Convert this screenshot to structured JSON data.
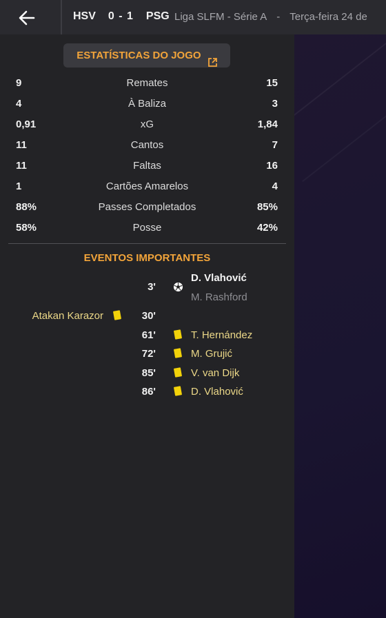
{
  "header": {
    "home_team": "HSV",
    "score": "0 - 1",
    "away_team": "PSG",
    "competition": "Liga SLFM - Série A",
    "separator": "-",
    "date": "Terça-feira 24 de"
  },
  "stats": {
    "title": "ESTATÍSTICAS DO JOGO",
    "rows": [
      {
        "home": "9",
        "label": "Remates",
        "away": "15"
      },
      {
        "home": "4",
        "label": "À Baliza",
        "away": "3"
      },
      {
        "home": "0,91",
        "label": "xG",
        "away": "1,84"
      },
      {
        "home": "11",
        "label": "Cantos",
        "away": "7"
      },
      {
        "home": "11",
        "label": "Faltas",
        "away": "16"
      },
      {
        "home": "1",
        "label": "Cartões Amarelos",
        "away": "4"
      },
      {
        "home": "88%",
        "label": "Passes Completados",
        "away": "85%"
      },
      {
        "home": "58%",
        "label": "Posse",
        "away": "42%"
      }
    ]
  },
  "events": {
    "title": "EVENTOS IMPORTANTES",
    "items": [
      {
        "minute": "3'",
        "type": "goal",
        "side": "away",
        "player": "D. Vlahović",
        "assist": "M. Rashford"
      },
      {
        "minute": "30'",
        "type": "yellow-card",
        "side": "home",
        "player": "Atakan Karazor"
      },
      {
        "minute": "61'",
        "type": "yellow-card",
        "side": "away",
        "player": "T. Hernández"
      },
      {
        "minute": "72'",
        "type": "yellow-card",
        "side": "away",
        "player": "M. Grujić"
      },
      {
        "minute": "85'",
        "type": "yellow-card",
        "side": "away",
        "player": "V. van Dijk"
      },
      {
        "minute": "86'",
        "type": "yellow-card",
        "side": "away",
        "player": "D. Vlahović"
      }
    ]
  },
  "colors": {
    "accent": "#f2a43a",
    "card": "#f2d20a"
  }
}
